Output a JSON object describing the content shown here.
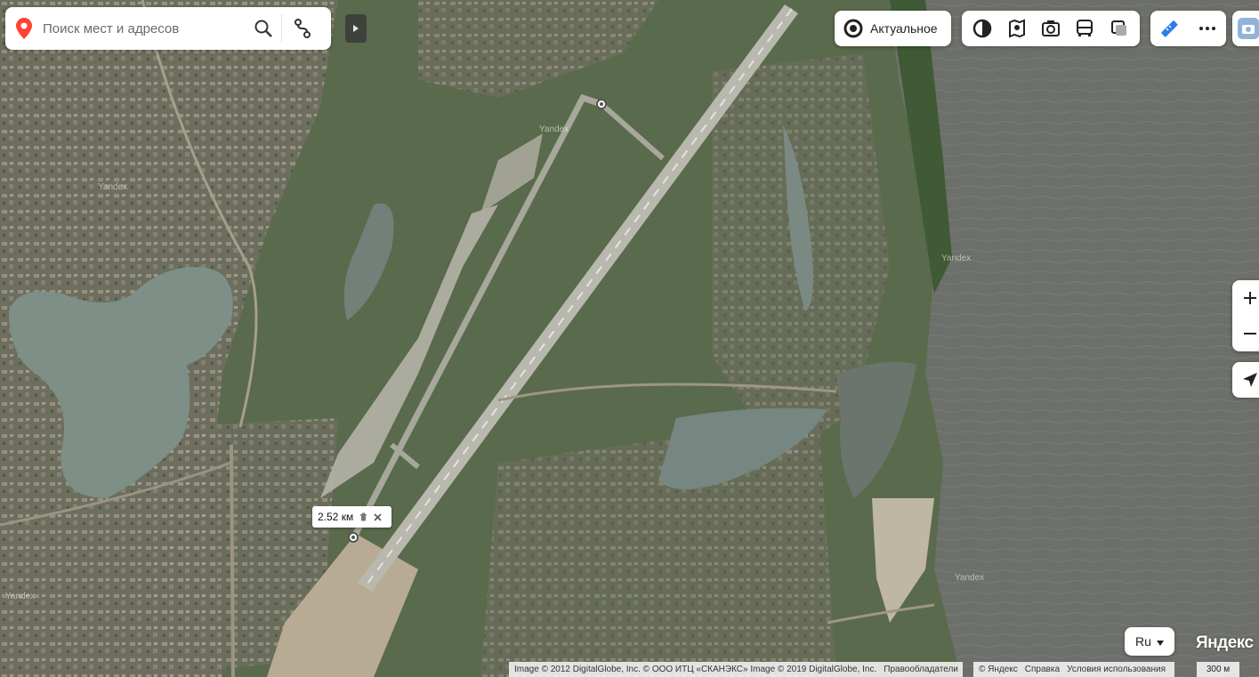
{
  "search": {
    "placeholder": "Поиск мест и адресов"
  },
  "top_controls": {
    "actual_label": "Актуальное",
    "layer_icons": [
      "map-type-icon",
      "traffic-icon",
      "panorama-icon",
      "transport-icon",
      "layers-icon"
    ],
    "tool_icons": [
      "ruler-icon",
      "more-icon"
    ]
  },
  "measurement": {
    "distance": "2.52 км"
  },
  "watermarks": [
    "Yandex",
    "Yandex",
    "Yandex",
    "Yandex",
    "Yandex"
  ],
  "language": {
    "selected": "Ru"
  },
  "brand": "Яндекс",
  "copyright": {
    "imagery": "Image © 2012 DigitalGlobe, Inc. © ООО ИТЦ «СКАНЭКС» Image © 2019 DigitalGlobe, Inc.",
    "rights_link": "Правообладатели",
    "yandex": "© Яндекс",
    "help_link": "Справка",
    "terms_link": "Условия использования"
  },
  "scale": "300 м",
  "colors": {
    "accent_red": "#f43",
    "ruler_blue": "#2b7de9",
    "water": "#6b6f6b",
    "lake": "#7f9288",
    "land": "#5b6a50"
  }
}
